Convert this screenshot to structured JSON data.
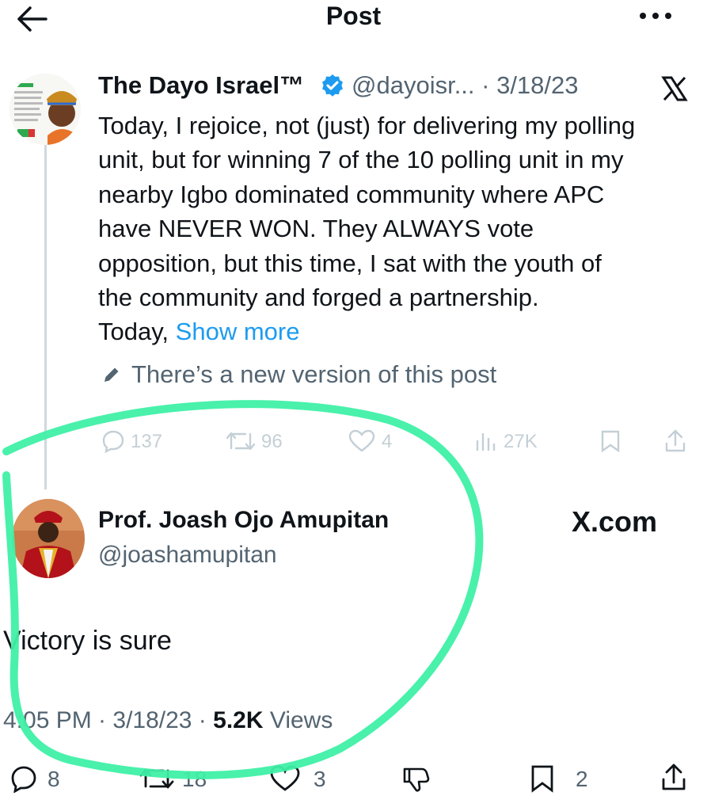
{
  "header": {
    "title": "Post"
  },
  "original_post": {
    "author_name": "The Dayo Israel™",
    "handle_date": "@dayoisr... · 3/18/23",
    "text_lines": [
      "Today, I rejoice, not (just) for delivering my polling",
      "unit, but for winning 7 of the 10 polling unit in my",
      "nearby Igbo dominated community where APC",
      "have NEVER WON. They ALWAYS vote",
      "opposition, but this time, I sat with the youth of",
      "the community and forged a partnership."
    ],
    "last_line_prefix": "Today, ",
    "show_more": "Show more",
    "new_version_note": "There’s a new version of this post",
    "metrics": {
      "replies": "137",
      "reposts": "96",
      "likes": "4",
      "views": "27K"
    }
  },
  "reply_post": {
    "author_name": "Prof. Joash Ojo Amupitan",
    "handle": "@joashamupitan",
    "watermark": "X.com",
    "text": "Victory is sure",
    "meta_prefix": "4:05 PM · 3/18/23 · ",
    "views_count": "5.2K",
    "views_label": " Views",
    "actions": {
      "replies": "8",
      "reposts": "18",
      "likes": "3",
      "bookmarks": "2"
    }
  },
  "colors": {
    "accent": "#1d9bf0",
    "annotation": "#3ff0a6",
    "muted": "#536471",
    "faint": "#c4cfd6"
  },
  "icons": [
    "back-arrow-icon",
    "more-icon",
    "verified-icon",
    "x-logo-icon",
    "pencil-icon",
    "reply-icon",
    "repost-icon",
    "like-icon",
    "views-icon",
    "bookmark-icon",
    "share-icon"
  ]
}
